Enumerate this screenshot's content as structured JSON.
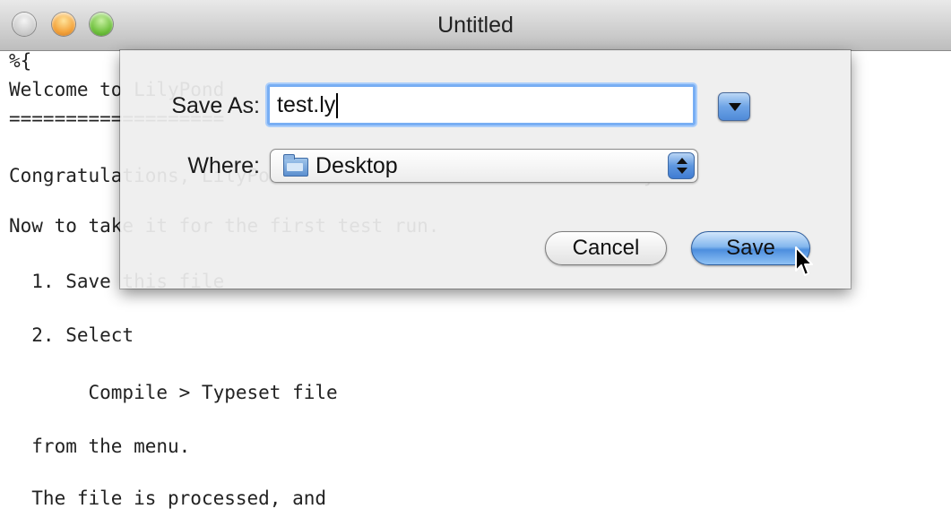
{
  "window": {
    "title": "Untitled"
  },
  "document": {
    "lines": [
      "%{",
      "Welcome to LilyPond",
      "===================",
      "",
      "Congratulations, LilyPond has been installed successfully.",
      "",
      "Now to take it for the first test run.",
      "",
      "  1. Save this file",
      "",
      "  2. Select",
      "",
      "       Compile > Typeset file",
      "",
      "  from the menu.",
      "",
      "  The file is processed, and"
    ]
  },
  "save_dialog": {
    "save_as_label": "Save As:",
    "save_as_value": "test.ly",
    "where_label": "Where:",
    "where_value": "Desktop",
    "cancel_label": "Cancel",
    "save_label": "Save"
  },
  "icons": {
    "expand": "disclosure-triangle-icon",
    "folder": "folder-icon",
    "popup": "popup-stepper-icon",
    "cursor": "mouse-pointer-icon"
  }
}
